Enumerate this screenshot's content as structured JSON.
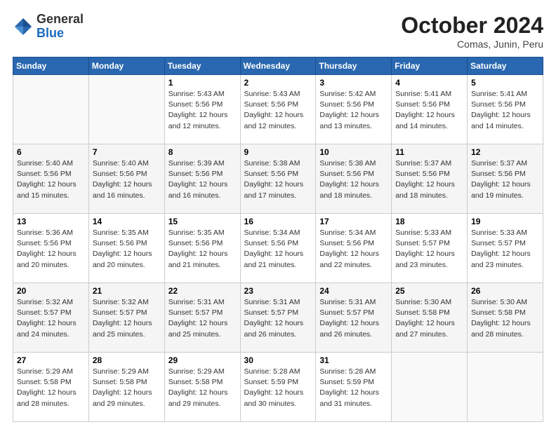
{
  "header": {
    "logo_general": "General",
    "logo_blue": "Blue",
    "month": "October 2024",
    "location": "Comas, Junin, Peru"
  },
  "days_of_week": [
    "Sunday",
    "Monday",
    "Tuesday",
    "Wednesday",
    "Thursday",
    "Friday",
    "Saturday"
  ],
  "weeks": [
    [
      {
        "day": "",
        "sunrise": "",
        "sunset": "",
        "daylight": ""
      },
      {
        "day": "",
        "sunrise": "",
        "sunset": "",
        "daylight": ""
      },
      {
        "day": "1",
        "sunrise": "Sunrise: 5:43 AM",
        "sunset": "Sunset: 5:56 PM",
        "daylight": "Daylight: 12 hours and 12 minutes."
      },
      {
        "day": "2",
        "sunrise": "Sunrise: 5:43 AM",
        "sunset": "Sunset: 5:56 PM",
        "daylight": "Daylight: 12 hours and 12 minutes."
      },
      {
        "day": "3",
        "sunrise": "Sunrise: 5:42 AM",
        "sunset": "Sunset: 5:56 PM",
        "daylight": "Daylight: 12 hours and 13 minutes."
      },
      {
        "day": "4",
        "sunrise": "Sunrise: 5:41 AM",
        "sunset": "Sunset: 5:56 PM",
        "daylight": "Daylight: 12 hours and 14 minutes."
      },
      {
        "day": "5",
        "sunrise": "Sunrise: 5:41 AM",
        "sunset": "Sunset: 5:56 PM",
        "daylight": "Daylight: 12 hours and 14 minutes."
      }
    ],
    [
      {
        "day": "6",
        "sunrise": "Sunrise: 5:40 AM",
        "sunset": "Sunset: 5:56 PM",
        "daylight": "Daylight: 12 hours and 15 minutes."
      },
      {
        "day": "7",
        "sunrise": "Sunrise: 5:40 AM",
        "sunset": "Sunset: 5:56 PM",
        "daylight": "Daylight: 12 hours and 16 minutes."
      },
      {
        "day": "8",
        "sunrise": "Sunrise: 5:39 AM",
        "sunset": "Sunset: 5:56 PM",
        "daylight": "Daylight: 12 hours and 16 minutes."
      },
      {
        "day": "9",
        "sunrise": "Sunrise: 5:38 AM",
        "sunset": "Sunset: 5:56 PM",
        "daylight": "Daylight: 12 hours and 17 minutes."
      },
      {
        "day": "10",
        "sunrise": "Sunrise: 5:38 AM",
        "sunset": "Sunset: 5:56 PM",
        "daylight": "Daylight: 12 hours and 18 minutes."
      },
      {
        "day": "11",
        "sunrise": "Sunrise: 5:37 AM",
        "sunset": "Sunset: 5:56 PM",
        "daylight": "Daylight: 12 hours and 18 minutes."
      },
      {
        "day": "12",
        "sunrise": "Sunrise: 5:37 AM",
        "sunset": "Sunset: 5:56 PM",
        "daylight": "Daylight: 12 hours and 19 minutes."
      }
    ],
    [
      {
        "day": "13",
        "sunrise": "Sunrise: 5:36 AM",
        "sunset": "Sunset: 5:56 PM",
        "daylight": "Daylight: 12 hours and 20 minutes."
      },
      {
        "day": "14",
        "sunrise": "Sunrise: 5:35 AM",
        "sunset": "Sunset: 5:56 PM",
        "daylight": "Daylight: 12 hours and 20 minutes."
      },
      {
        "day": "15",
        "sunrise": "Sunrise: 5:35 AM",
        "sunset": "Sunset: 5:56 PM",
        "daylight": "Daylight: 12 hours and 21 minutes."
      },
      {
        "day": "16",
        "sunrise": "Sunrise: 5:34 AM",
        "sunset": "Sunset: 5:56 PM",
        "daylight": "Daylight: 12 hours and 21 minutes."
      },
      {
        "day": "17",
        "sunrise": "Sunrise: 5:34 AM",
        "sunset": "Sunset: 5:56 PM",
        "daylight": "Daylight: 12 hours and 22 minutes."
      },
      {
        "day": "18",
        "sunrise": "Sunrise: 5:33 AM",
        "sunset": "Sunset: 5:57 PM",
        "daylight": "Daylight: 12 hours and 23 minutes."
      },
      {
        "day": "19",
        "sunrise": "Sunrise: 5:33 AM",
        "sunset": "Sunset: 5:57 PM",
        "daylight": "Daylight: 12 hours and 23 minutes."
      }
    ],
    [
      {
        "day": "20",
        "sunrise": "Sunrise: 5:32 AM",
        "sunset": "Sunset: 5:57 PM",
        "daylight": "Daylight: 12 hours and 24 minutes."
      },
      {
        "day": "21",
        "sunrise": "Sunrise: 5:32 AM",
        "sunset": "Sunset: 5:57 PM",
        "daylight": "Daylight: 12 hours and 25 minutes."
      },
      {
        "day": "22",
        "sunrise": "Sunrise: 5:31 AM",
        "sunset": "Sunset: 5:57 PM",
        "daylight": "Daylight: 12 hours and 25 minutes."
      },
      {
        "day": "23",
        "sunrise": "Sunrise: 5:31 AM",
        "sunset": "Sunset: 5:57 PM",
        "daylight": "Daylight: 12 hours and 26 minutes."
      },
      {
        "day": "24",
        "sunrise": "Sunrise: 5:31 AM",
        "sunset": "Sunset: 5:57 PM",
        "daylight": "Daylight: 12 hours and 26 minutes."
      },
      {
        "day": "25",
        "sunrise": "Sunrise: 5:30 AM",
        "sunset": "Sunset: 5:58 PM",
        "daylight": "Daylight: 12 hours and 27 minutes."
      },
      {
        "day": "26",
        "sunrise": "Sunrise: 5:30 AM",
        "sunset": "Sunset: 5:58 PM",
        "daylight": "Daylight: 12 hours and 28 minutes."
      }
    ],
    [
      {
        "day": "27",
        "sunrise": "Sunrise: 5:29 AM",
        "sunset": "Sunset: 5:58 PM",
        "daylight": "Daylight: 12 hours and 28 minutes."
      },
      {
        "day": "28",
        "sunrise": "Sunrise: 5:29 AM",
        "sunset": "Sunset: 5:58 PM",
        "daylight": "Daylight: 12 hours and 29 minutes."
      },
      {
        "day": "29",
        "sunrise": "Sunrise: 5:29 AM",
        "sunset": "Sunset: 5:58 PM",
        "daylight": "Daylight: 12 hours and 29 minutes."
      },
      {
        "day": "30",
        "sunrise": "Sunrise: 5:28 AM",
        "sunset": "Sunset: 5:59 PM",
        "daylight": "Daylight: 12 hours and 30 minutes."
      },
      {
        "day": "31",
        "sunrise": "Sunrise: 5:28 AM",
        "sunset": "Sunset: 5:59 PM",
        "daylight": "Daylight: 12 hours and 31 minutes."
      },
      {
        "day": "",
        "sunrise": "",
        "sunset": "",
        "daylight": ""
      },
      {
        "day": "",
        "sunrise": "",
        "sunset": "",
        "daylight": ""
      }
    ]
  ]
}
